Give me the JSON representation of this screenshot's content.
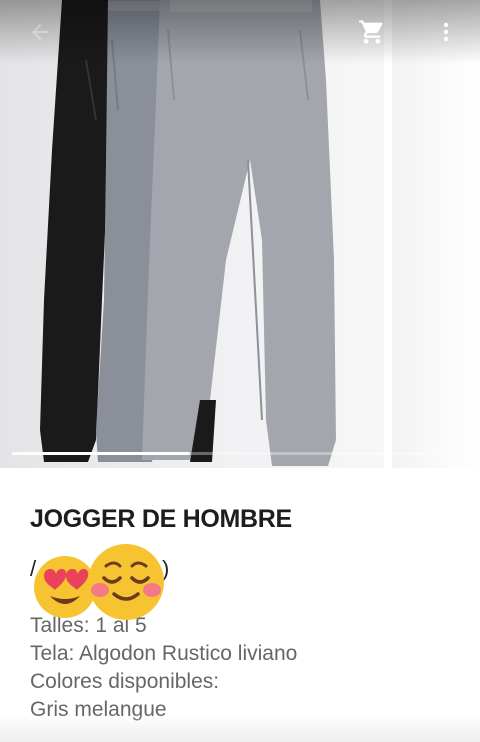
{
  "toolbar": {
    "back_icon": "arrow-back-icon",
    "cart_icon": "shopping-cart-icon",
    "more_icon": "more-vert-icon"
  },
  "gallery": {
    "image_alt": "pantalones jogger negro, gris oscuro y gris claro",
    "current_index": 1,
    "total": 2
  },
  "product": {
    "title": "JOGGER DE HOMBRE",
    "price_fragment_left": "/",
    "price_fragment_right": ")",
    "details": [
      "Talles: 1 al 5",
      "Tela: Algodon Rustico liviano",
      "Colores disponibles:",
      "Gris melangue"
    ]
  },
  "stickers": [
    "heart-eyes-emoji",
    "blushing-smile-emoji"
  ],
  "colors": {
    "text_primary": "#1d1d1d",
    "text_secondary": "#666666",
    "emoji_yellow": "#f6c431"
  }
}
